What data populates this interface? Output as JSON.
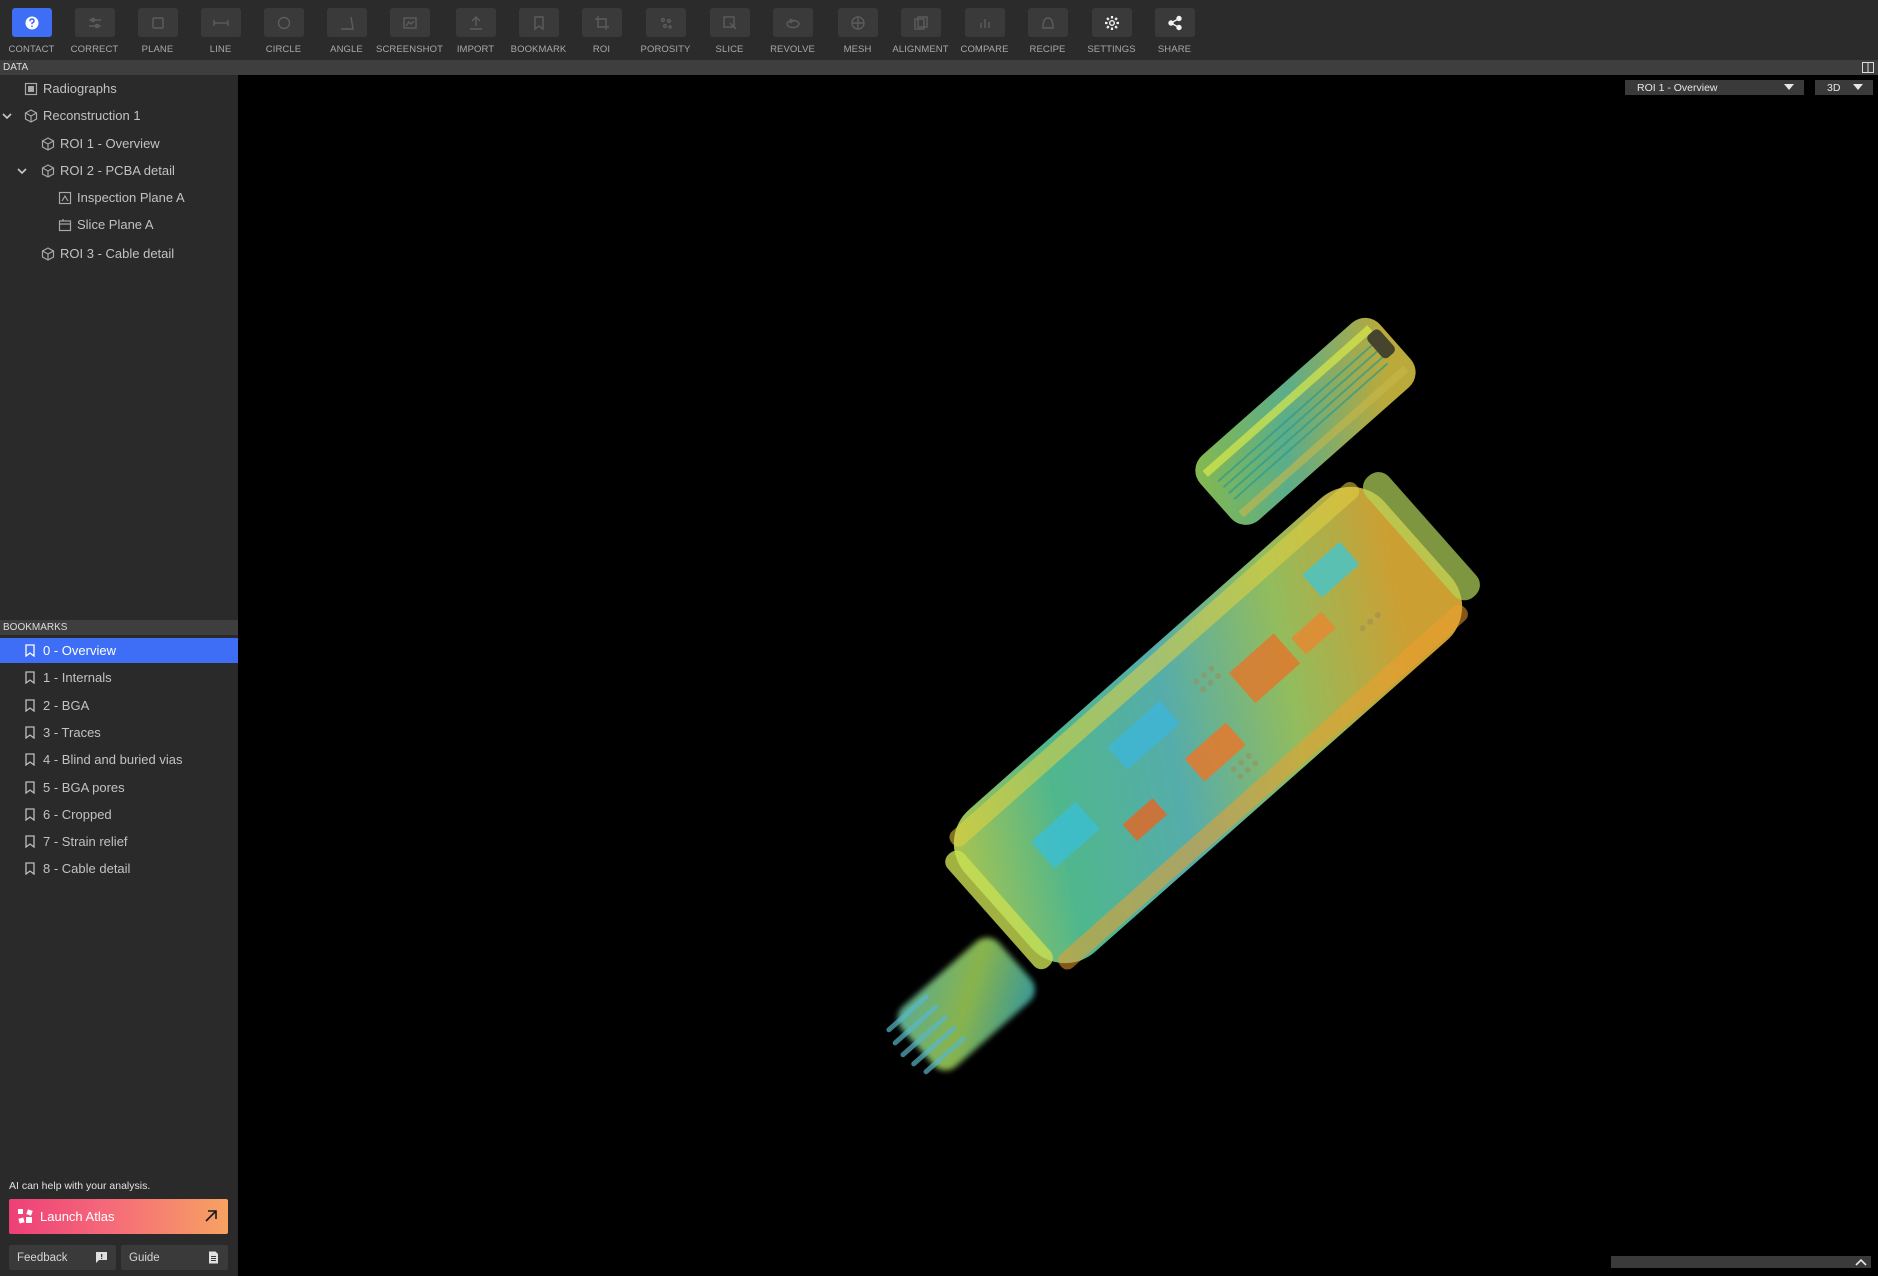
{
  "toolbar": {
    "tools": [
      {
        "label": "CONTACT",
        "icon": "question-icon",
        "state": "active"
      },
      {
        "label": "CORRECT",
        "icon": "sliders-icon",
        "state": "dim"
      },
      {
        "label": "PLANE",
        "icon": "plane-icon",
        "state": "dim"
      },
      {
        "label": "LINE",
        "icon": "line-icon",
        "state": "dim"
      },
      {
        "label": "CIRCLE",
        "icon": "circle-icon",
        "state": "dim"
      },
      {
        "label": "ANGLE",
        "icon": "angle-icon",
        "state": "dim"
      },
      {
        "label": "SCREENSHOT",
        "icon": "screenshot-icon",
        "state": "dim"
      },
      {
        "label": "IMPORT",
        "icon": "import-icon",
        "state": "dim"
      },
      {
        "label": "BOOKMARK",
        "icon": "bookmark-icon",
        "state": "dim"
      },
      {
        "label": "ROI",
        "icon": "crop-icon",
        "state": "dim"
      },
      {
        "label": "POROSITY",
        "icon": "porosity-icon",
        "state": "dim"
      },
      {
        "label": "SLICE",
        "icon": "slice-icon",
        "state": "dim"
      },
      {
        "label": "REVOLVE",
        "icon": "revolve-icon",
        "state": "dim"
      },
      {
        "label": "MESH",
        "icon": "mesh-icon",
        "state": "dim"
      },
      {
        "label": "ALIGNMENT",
        "icon": "alignment-icon",
        "state": "dim"
      },
      {
        "label": "COMPARE",
        "icon": "bar-chart-icon",
        "state": "dim"
      },
      {
        "label": "RECIPE",
        "icon": "recipe-icon",
        "state": "dim"
      },
      {
        "label": "SETTINGS",
        "icon": "gear-icon",
        "state": "bright"
      },
      {
        "label": "SHARE",
        "icon": "share-icon",
        "state": "bright"
      }
    ]
  },
  "sidebar": {
    "data_header": "DATA",
    "tree": [
      {
        "label": "Radiographs",
        "icon": "radiograph-icon",
        "depth": 0,
        "expanded": null
      },
      {
        "label": "Reconstruction 1",
        "icon": "cube-icon",
        "depth": 0,
        "expanded": true
      },
      {
        "label": "ROI 1 - Overview",
        "icon": "cube-icon",
        "depth": 1,
        "expanded": null
      },
      {
        "label": "ROI 2 - PCBA detail",
        "icon": "cube-icon",
        "depth": 1,
        "expanded": true
      },
      {
        "label": "Inspection Plane A",
        "icon": "inspection-plane-icon",
        "depth": 2,
        "expanded": null
      },
      {
        "label": "Slice Plane A",
        "icon": "slice-plane-icon",
        "depth": 2,
        "expanded": null
      },
      {
        "label": "ROI 3 - Cable detail",
        "icon": "cube-icon",
        "depth": 1,
        "expanded": null
      }
    ],
    "bookmarks_header": "BOOKMARKS",
    "bookmarks": [
      {
        "label": "0 - Overview",
        "selected": true
      },
      {
        "label": "1 - Internals",
        "selected": false
      },
      {
        "label": "2 - BGA",
        "selected": false
      },
      {
        "label": "3 - Traces",
        "selected": false
      },
      {
        "label": "4 - Blind and buried vias",
        "selected": false
      },
      {
        "label": "5 - BGA pores",
        "selected": false
      },
      {
        "label": "6 - Cropped",
        "selected": false
      },
      {
        "label": "7 - Strain relief",
        "selected": false
      },
      {
        "label": "8 - Cable detail",
        "selected": false
      }
    ],
    "atlas": {
      "hint": "AI can help with your analysis.",
      "button_label": "Launch Atlas"
    },
    "feedback_label": "Feedback",
    "guide_label": "Guide"
  },
  "viewport": {
    "roi_select": "ROI 1 - Overview",
    "view_mode": "3D"
  },
  "colors": {
    "accent": "#3d6ef5",
    "toolbar_bg": "#2b2b2b",
    "sidebar_bg": "#2a2a2a",
    "header_bg": "#3e3e3e",
    "atlas_gradient_start": "#ee3f77",
    "atlas_gradient_end": "#f7a262"
  }
}
